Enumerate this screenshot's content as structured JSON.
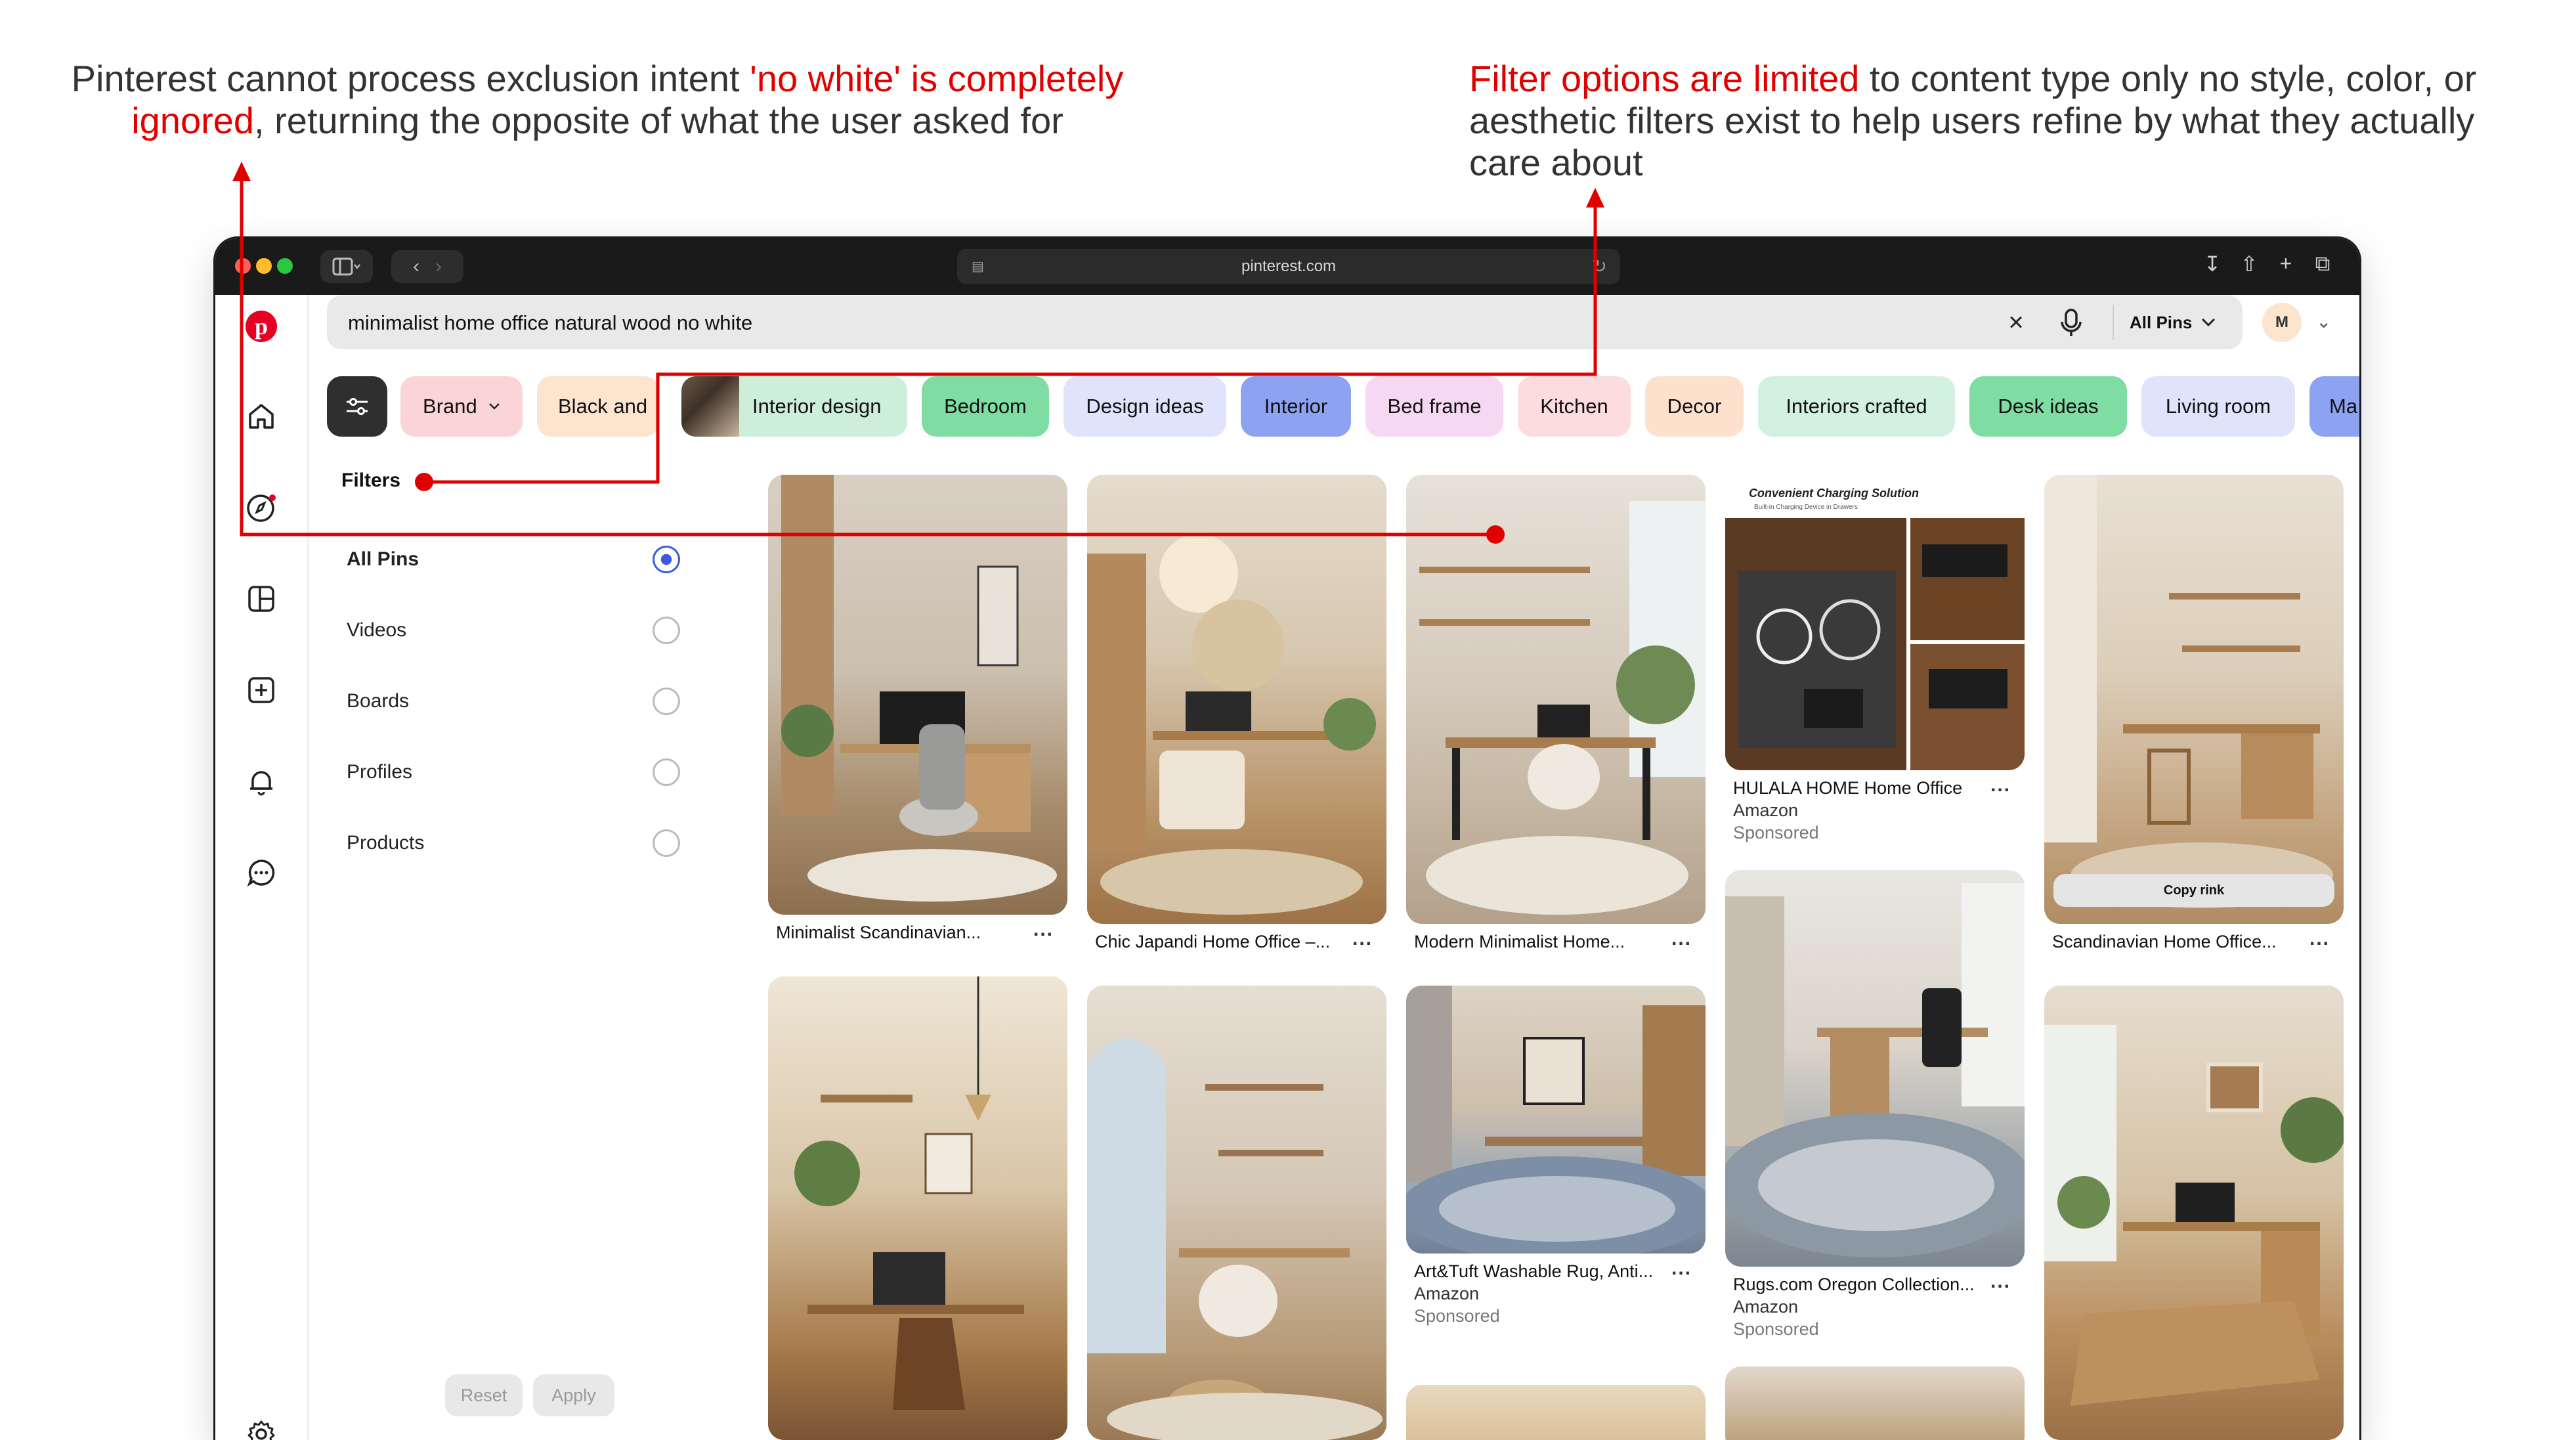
{
  "annotations": {
    "left": {
      "text_before": "Pinterest cannot process exclusion intent ",
      "highlight": "'no white' is completely ignored",
      "text_after": ", returning the opposite of what the user asked for"
    },
    "right": {
      "highlight": "Filter options are limited",
      "text_after": " to content type only no style, color, or aesthetic filters exist to help users refine by what they actually care about"
    },
    "accent_color": "#e00000"
  },
  "browser": {
    "address": "pinterest.com"
  },
  "search": {
    "query": "minimalist home office natural wood no white",
    "scope": "All Pins"
  },
  "account": {
    "initial": "M"
  },
  "chips": [
    {
      "label": "Brand",
      "color": "#fbd5d5",
      "dropdown": true
    },
    {
      "label": "Black and",
      "color": "#fde4cf"
    },
    {
      "label": "Interior design",
      "color": "#cdeed9"
    },
    {
      "label": "Bedroom",
      "color": "#7fdca2"
    },
    {
      "label": "Design ideas",
      "color": "#dfe3fb"
    },
    {
      "label": "Interior",
      "color": "#8ea2f2"
    },
    {
      "label": "Bed frame",
      "color": "#f6d8f3"
    },
    {
      "label": "Kitchen",
      "color": "#fcdcdc"
    },
    {
      "label": "Decor",
      "color": "#fde1cc"
    },
    {
      "label": "Interiors crafted",
      "color": "#d2f1e1"
    },
    {
      "label": "Desk ideas",
      "color": "#7fdca2"
    },
    {
      "label": "Living room",
      "color": "#dfe3fb"
    },
    {
      "label": "Ma",
      "color": "#8ea2f2"
    }
  ],
  "filters": {
    "title": "Filters",
    "options": [
      {
        "label": "All Pins",
        "selected": true
      },
      {
        "label": "Videos",
        "selected": false
      },
      {
        "label": "Boards",
        "selected": false
      },
      {
        "label": "Profiles",
        "selected": false
      },
      {
        "label": "Products",
        "selected": false
      }
    ],
    "reset_label": "Reset",
    "apply_label": "Apply"
  },
  "pins": {
    "col1": [
      {
        "title": "Minimalist Scandinavian..."
      }
    ],
    "col2": [
      {
        "title": "Chic Japandi Home Office –..."
      }
    ],
    "col3": [
      {
        "title": "Modern Minimalist Home..."
      },
      {
        "title": "Art&Tuft Washable Rug, Anti...",
        "source": "Amazon",
        "sponsored": "Sponsored"
      }
    ],
    "col4": [
      {
        "ad_heading": "Convenient Charging Solution",
        "ad_sub": "Built-in Charging Device in Drawers",
        "title": "HULALA HOME Home Office",
        "source": "Amazon",
        "sponsored": "Sponsored"
      },
      {
        "title": "Rugs.com Oregon Collection...",
        "source": "Amazon",
        "sponsored": "Sponsored"
      }
    ],
    "col5": [
      {
        "title": "Scandinavian Home Office...",
        "overlay_button": "Copy rink"
      }
    ],
    "more_label": "..."
  }
}
